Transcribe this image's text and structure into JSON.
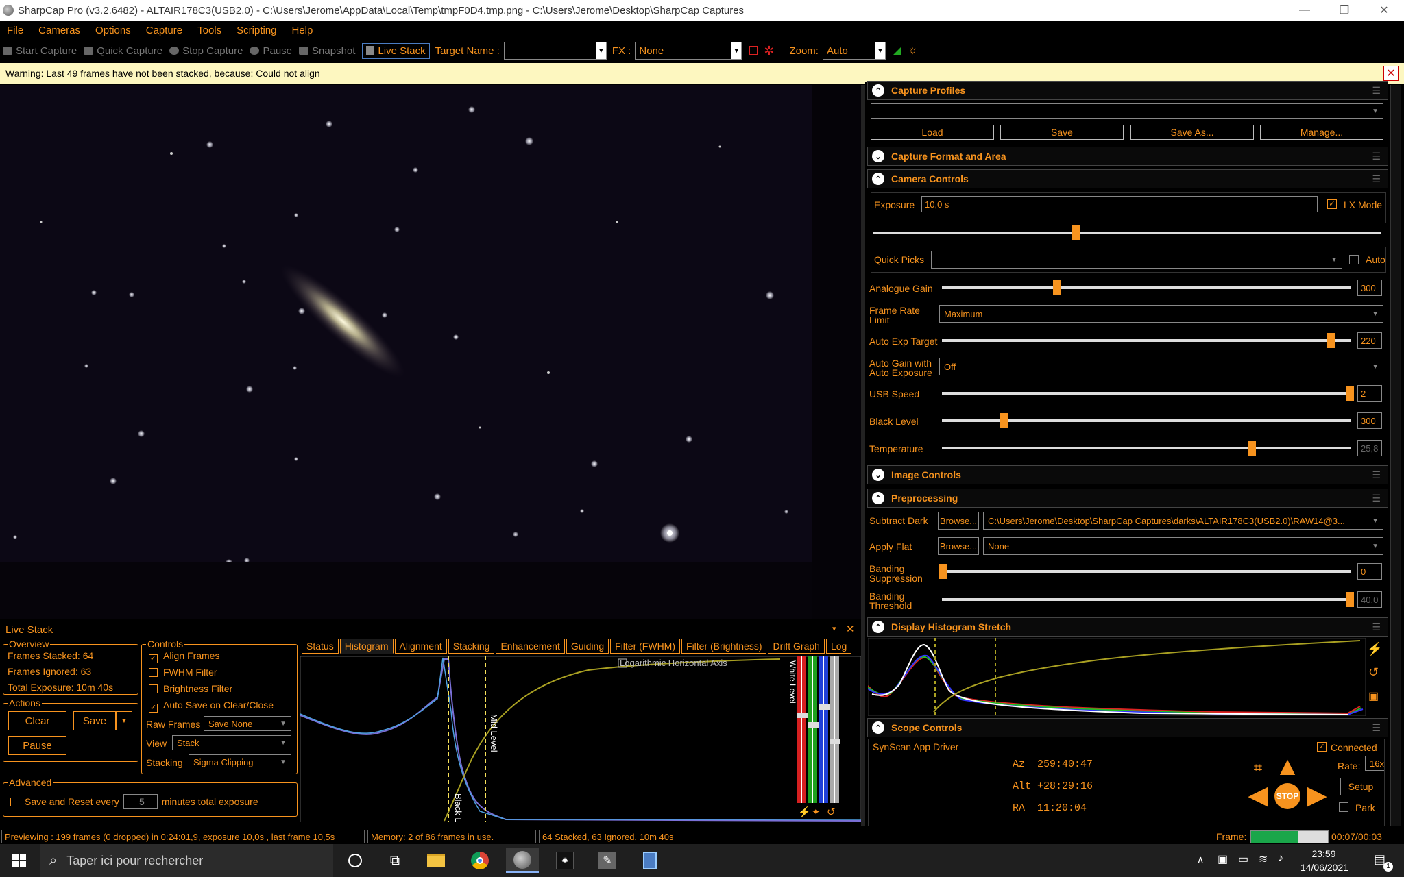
{
  "window": {
    "title": "SharpCap Pro (v3.2.6482) - ALTAIR178C3(USB2.0) - C:\\Users\\Jerome\\AppData\\Local\\Temp\\tmpF0D4.tmp.png - C:\\Users\\Jerome\\Desktop\\SharpCap Captures",
    "min": "—",
    "max": "❐",
    "close": "✕"
  },
  "menu": [
    "File",
    "Cameras",
    "Options",
    "Capture",
    "Tools",
    "Scripting",
    "Help"
  ],
  "toolbar": {
    "start_capture": "Start Capture",
    "quick_capture": "Quick Capture",
    "stop_capture": "Stop Capture",
    "pause": "Pause",
    "snapshot": "Snapshot",
    "live_stack": "Live Stack",
    "target_name_label": "Target Name :",
    "target_name_value": "",
    "fx_label": "FX :",
    "fx_value": "None",
    "zoom_label": "Zoom:",
    "zoom_value": "Auto"
  },
  "warning": {
    "text": "Warning: Last 49 frames have not been stacked, because: Could not align",
    "close": "✕"
  },
  "livestack": {
    "title": "Live Stack",
    "pin": "📌",
    "close": "✕",
    "overview_label": "Overview",
    "frames_stacked": "Frames Stacked: 64",
    "frames_ignored": "Frames Ignored:  63",
    "total_exposure": "Total Exposure:   10m 40s",
    "actions_label": "Actions",
    "clear": "Clear",
    "save": "Save",
    "pause": "Pause",
    "advanced_label": "Advanced",
    "save_reset_label": "Save and Reset every",
    "save_reset_value": "5",
    "save_reset_suffix": "minutes total exposure",
    "controls_label": "Controls",
    "align_frames": "Align Frames",
    "fwhm_filter": "FWHM Filter",
    "brightness_filter": "Brightness Filter",
    "auto_save": "Auto Save on Clear/Close",
    "raw_frames_label": "Raw Frames",
    "raw_frames_value": "Save None",
    "view_label": "View",
    "view_value": "Stack",
    "stacking_label": "Stacking",
    "stacking_value": "Sigma Clipping",
    "tabs": [
      "Status",
      "Histogram",
      "Alignment",
      "Stacking",
      "Enhancement",
      "Guiding",
      "Filter (FWHM)",
      "Filter (Brightness)",
      "Drift Graph",
      "Log"
    ],
    "active_tab": "Histogram",
    "log_axis": "Logarithmic Horizontal Axis",
    "black_level": "Black Level",
    "mid_level": "Mid Level",
    "white_level": "White Level"
  },
  "right": {
    "capture_profiles": "Capture Profiles",
    "profile_load": "Load",
    "profile_save": "Save",
    "profile_saveas": "Save As...",
    "profile_manage": "Manage...",
    "capture_format": "Capture Format and Area",
    "camera_controls": "Camera Controls",
    "exposure_label": "Exposure",
    "exposure_value": "10,0 s",
    "lx_mode": "LX Mode",
    "quick_picks": "Quick Picks",
    "auto": "Auto",
    "analogue_gain": "Analogue Gain",
    "analogue_gain_value": "300",
    "frame_rate_limit": "Frame Rate Limit",
    "frame_rate_value": "Maximum",
    "auto_exp_target": "Auto Exp Target",
    "auto_exp_value": "220",
    "auto_gain": "Auto Gain with Auto Exposure",
    "auto_gain_value": "Off",
    "usb_speed": "USB Speed",
    "usb_speed_value": "2",
    "black_level": "Black Level",
    "black_level_value": "300",
    "temperature": "Temperature",
    "temperature_value": "25,8",
    "image_controls": "Image Controls",
    "preprocessing": "Preprocessing",
    "subtract_dark": "Subtract Dark",
    "browse": "Browse...",
    "dark_path": "C:\\Users\\Jerome\\Desktop\\SharpCap Captures\\darks\\ALTAIR178C3(USB2.0)\\RAW14@3...",
    "apply_flat": "Apply Flat",
    "flat_value": "None",
    "banding_suppression": "Banding Suppression",
    "banding_suppression_value": "0",
    "banding_threshold": "Banding Threshold",
    "banding_threshold_value": "40,0",
    "display_histogram": "Display Histogram Stretch",
    "scope_controls": "Scope Controls",
    "scope_driver": "SynScan App Driver",
    "connected": "Connected",
    "az": "Az  259:40:47",
    "alt": "Alt +28:29:16",
    "ra": "RA  11:20:04",
    "rate_label": "Rate:",
    "rate_value": "16x",
    "setup": "Setup",
    "park": "Park",
    "stop": "STOP"
  },
  "status": {
    "previewing": "Previewing : 199 frames (0 dropped) in 0:24:01,9, exposure 10,0s , last frame 10,5s",
    "memory": "Memory: 2 of 86 frames in use.",
    "stacked": "64 Stacked, 63 Ignored, 10m 40s",
    "frame_label": "Frame:",
    "frame_progress": 0.62,
    "frame_time": "00:07/00:03"
  },
  "taskbar": {
    "search_placeholder": "Taper ici pour rechercher",
    "time": "23:59",
    "date": "14/06/2021",
    "notifications": "1"
  },
  "colors": {
    "accent": "#f7931e",
    "warning_bg": "#fdf7c0",
    "sky": "#050308"
  }
}
